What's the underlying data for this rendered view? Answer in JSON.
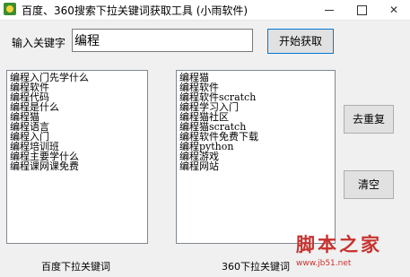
{
  "window": {
    "title": "百度、360搜索下拉关键词获取工具      (小雨软件)",
    "minimize": "—",
    "maximize": "□",
    "close": "✕"
  },
  "search": {
    "label": "输入关键字",
    "value": "编程",
    "start_button": "开始获取"
  },
  "buttons": {
    "reset": "去重复",
    "clear": "清空"
  },
  "lists": {
    "baidu": {
      "caption": "百度下拉关键词",
      "items": [
        "编程入门先学什么",
        "编程软件",
        "编程代码",
        "编程是什么",
        "编程猫",
        "编程语言",
        "编程入门",
        "编程培训班",
        "编程主要学什么",
        "编程课网课免费"
      ]
    },
    "so360": {
      "caption": "360下拉关键词",
      "items": [
        "编程猫",
        "编程软件",
        "编程软件scratch",
        "编程学习入门",
        "编程猫社区",
        "编程猫scratch",
        "编程软件免费下载",
        "编程python",
        "编程游戏",
        "编程网站"
      ]
    }
  },
  "watermark": {
    "text": "脚本之家",
    "url": "www.jb51.net"
  },
  "icons": {
    "app": "app-icon",
    "min": "minimize-icon",
    "max": "maximize-icon",
    "close": "close-icon"
  }
}
